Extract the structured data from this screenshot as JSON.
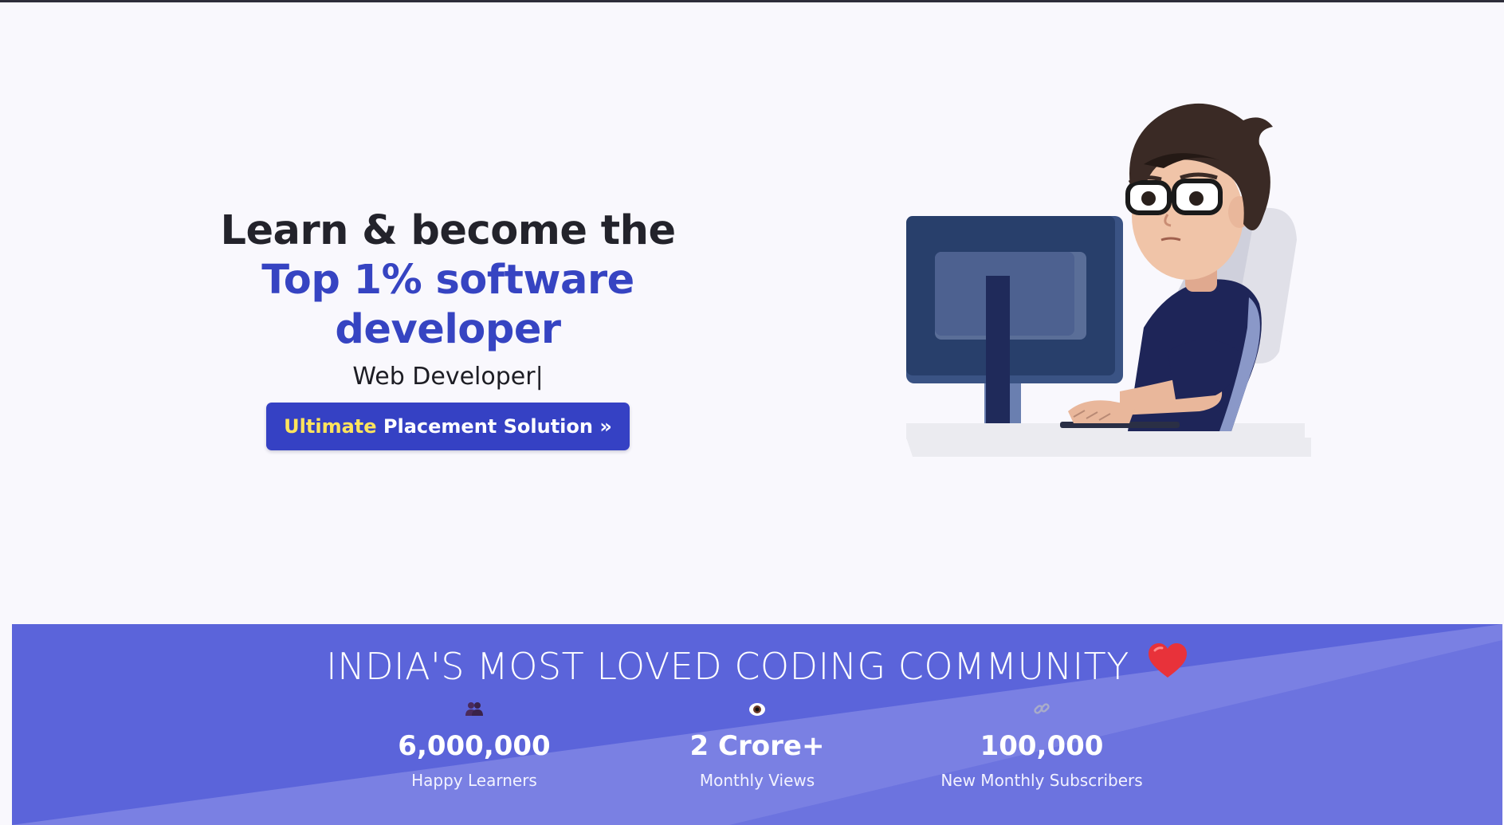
{
  "hero": {
    "headline_line1": "Learn & become the",
    "headline_line2": "Top 1% software developer",
    "typed_text": "Web Developer",
    "typed_cursor": "|",
    "cta": {
      "highlight": "Ultimate",
      "label": " Placement Solution »"
    },
    "illustration": "developer-at-computer-illustration"
  },
  "community": {
    "title": "INDIA'S MOST LOVED CODING COMMUNITY",
    "title_icon": "heart-icon",
    "stats": [
      {
        "icon": "people-icon",
        "value": "6,000,000",
        "label": "Happy Learners"
      },
      {
        "icon": "eye-icon",
        "value": "2 Crore+",
        "label": "Monthly Views"
      },
      {
        "icon": "link-icon",
        "value": "100,000",
        "label": "New Monthly Subscribers"
      }
    ]
  },
  "colors": {
    "accent_blue": "#3541c4",
    "highlight_yellow": "#ffe45c",
    "band_blue": "#5b64da",
    "band_light": "#7a80e3",
    "heart_red": "#e8323a"
  }
}
